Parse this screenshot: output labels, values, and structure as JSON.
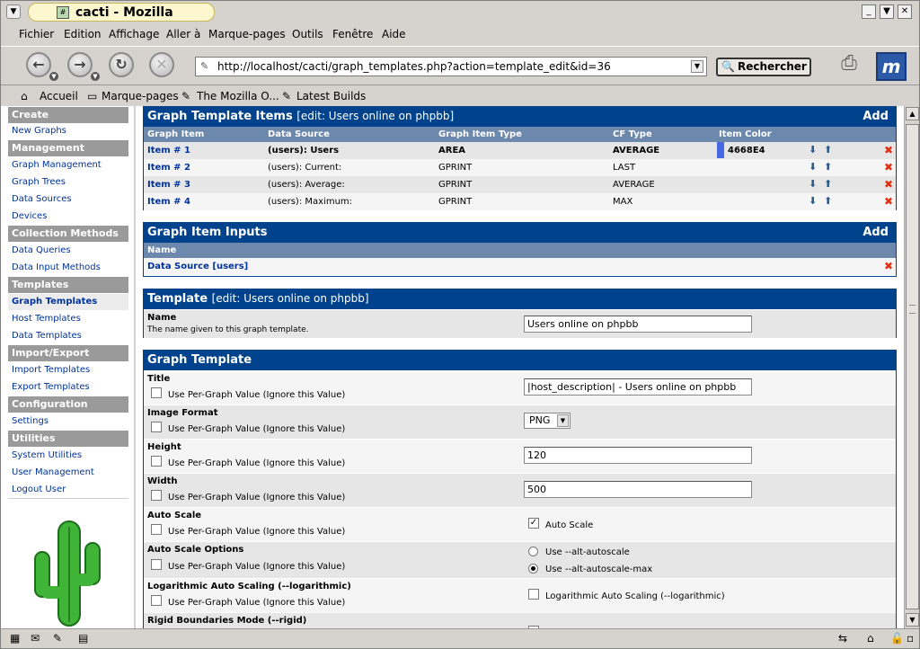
{
  "window": {
    "title": "cacti - Mozilla"
  },
  "menu": [
    "Fichier",
    "Edition",
    "Affichage",
    "Aller à",
    "Marque-pages",
    "Outils",
    "Fenêtre",
    "Aide"
  ],
  "nav": {
    "url": "http://localhost/cacti/graph_templates.php?action=template_edit&id=36",
    "search_label": "Rechercher"
  },
  "bookmarks": [
    "Accueil",
    "Marque-pages",
    "The Mozilla O...",
    "Latest Builds"
  ],
  "sidebar": {
    "create": "Create",
    "new_graphs": "New Graphs",
    "management": "Management",
    "graph_management": "Graph Management",
    "graph_trees": "Graph Trees",
    "data_sources": "Data Sources",
    "devices": "Devices",
    "collection_methods": "Collection Methods",
    "data_queries": "Data Queries",
    "data_input_methods": "Data Input Methods",
    "templates": "Templates",
    "graph_templates": "Graph Templates",
    "host_templates": "Host Templates",
    "data_templates": "Data Templates",
    "import_export": "Import/Export",
    "import_templates": "Import Templates",
    "export_templates": "Export Templates",
    "configuration": "Configuration",
    "settings": "Settings",
    "utilities": "Utilities",
    "system_utilities": "System Utilities",
    "user_management": "User Management",
    "logout_user": "Logout User"
  },
  "items": {
    "title": "Graph Template Items",
    "sub": "[edit: Users online on phpbb]",
    "add": "Add",
    "headers": [
      "Graph Item",
      "Data Source",
      "Graph Item Type",
      "CF Type",
      "Item Color"
    ],
    "rows": [
      {
        "item": "Item # 1",
        "source": "(users): Users",
        "type": "AREA",
        "cf": "AVERAGE",
        "color": "4668E4"
      },
      {
        "item": "Item # 2",
        "source": "(users): Current:",
        "type": "GPRINT",
        "cf": "LAST",
        "color": ""
      },
      {
        "item": "Item # 3",
        "source": "(users): Average:",
        "type": "GPRINT",
        "cf": "AVERAGE",
        "color": ""
      },
      {
        "item": "Item # 4",
        "source": "(users): Maximum:",
        "type": "GPRINT",
        "cf": "MAX",
        "color": ""
      }
    ],
    "swatch_color": "#4668E4"
  },
  "inputs": {
    "title": "Graph Item Inputs",
    "add": "Add",
    "header": "Name",
    "row": "Data Source [users]"
  },
  "template": {
    "title": "Template",
    "sub": "[edit: Users online on phpbb]",
    "name_label": "Name",
    "name_desc": "The name given to this graph template.",
    "name_value": "Users online on phpbb"
  },
  "graph": {
    "title": "Graph Template",
    "per_graph": "Use Per-Graph Value (Ignore this Value)",
    "title_label": "Title",
    "title_value": "|host_description| - Users online on phpbb",
    "format_label": "Image Format",
    "format_value": "PNG",
    "height_label": "Height",
    "height_value": "120",
    "width_label": "Width",
    "width_value": "500",
    "autoscale_label": "Auto Scale",
    "autoscale_cb": "Auto Scale",
    "options_label": "Auto Scale Options",
    "opt1": "Use --alt-autoscale",
    "opt2": "Use --alt-autoscale-max",
    "log_label": "Logarithmic Auto Scaling (--logarithmic)",
    "log_cb": "Logarithmic Auto Scaling (--logarithmic)",
    "rigid_label": "Rigid Boundaries Mode (--rigid)"
  },
  "colors": {
    "header_blue": "#00438C",
    "delete_red": "#E03010"
  }
}
